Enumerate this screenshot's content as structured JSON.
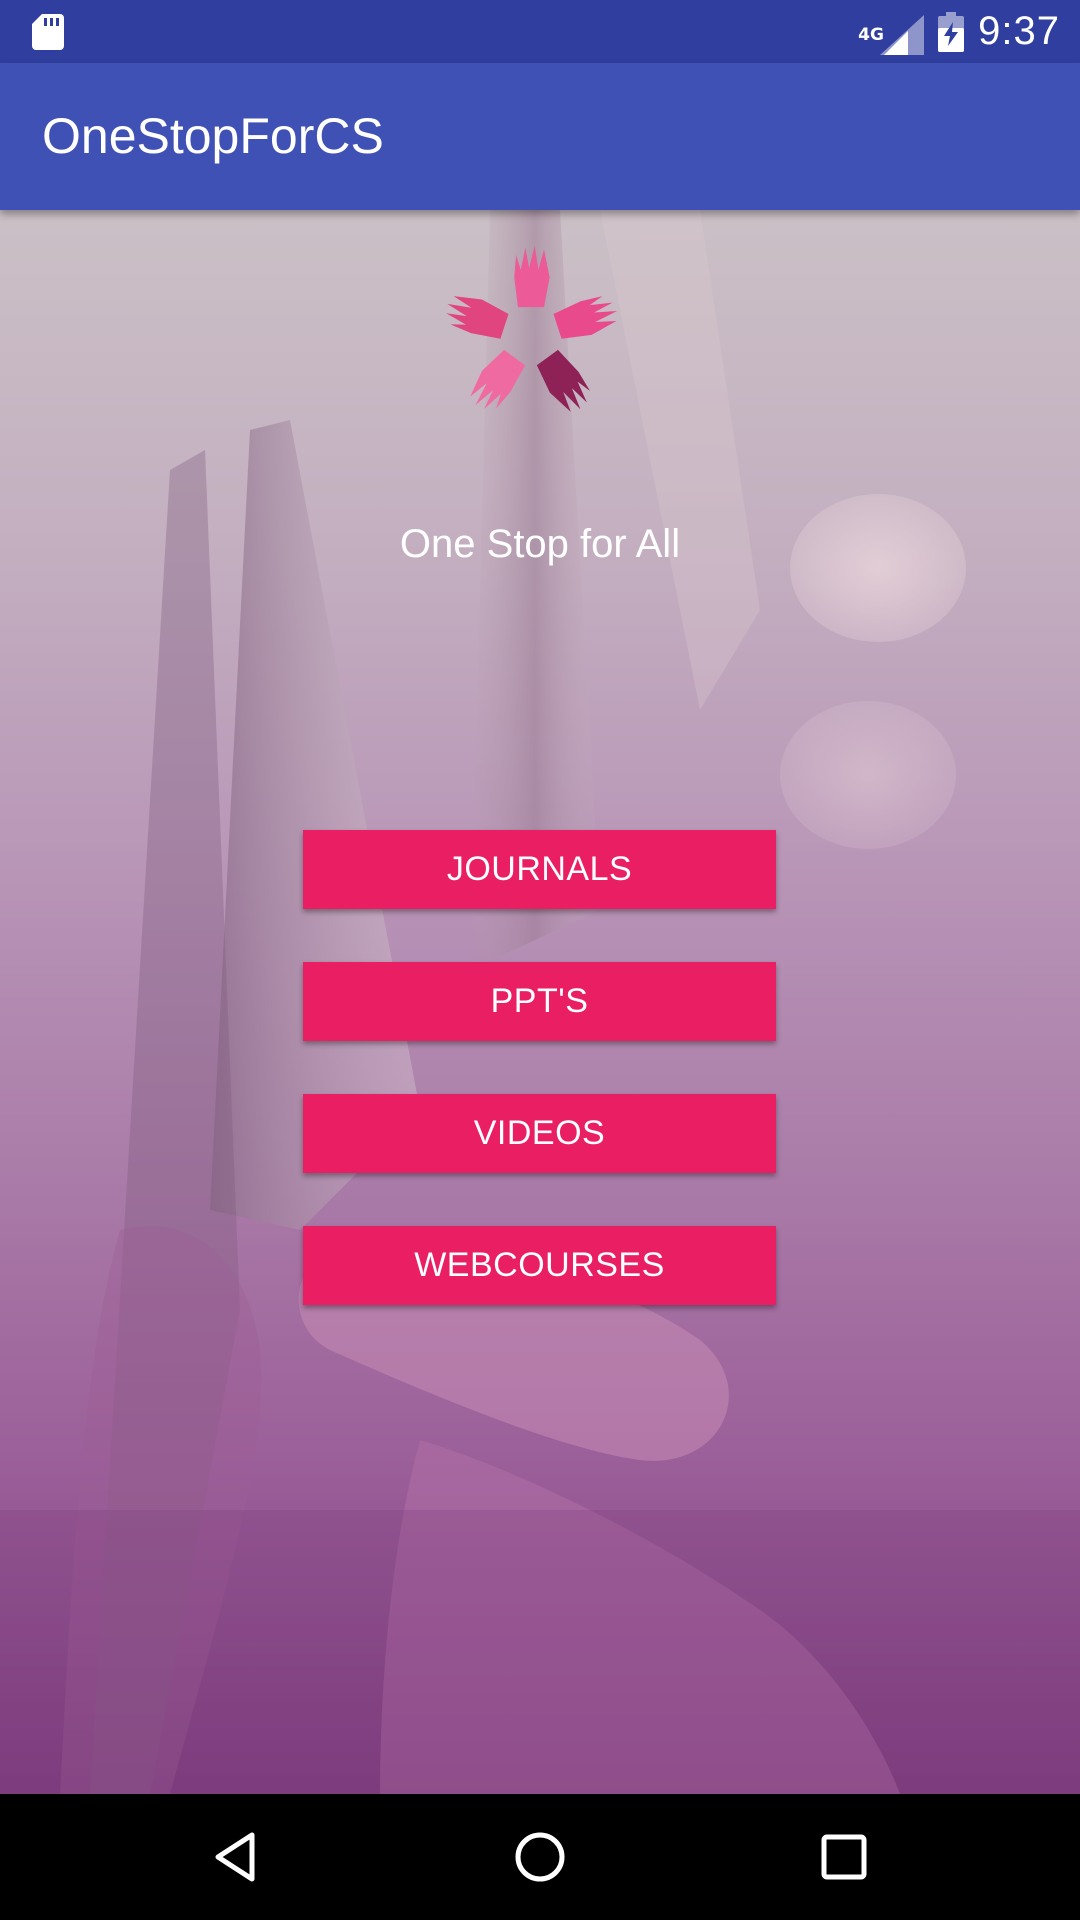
{
  "status_bar": {
    "network_type": "4G",
    "time": "9:37",
    "icons": [
      "sd-card-icon",
      "signal-icon",
      "battery-charging-icon"
    ]
  },
  "app_bar": {
    "title": "OneStopForCS"
  },
  "main": {
    "logo_icon": "hands-star-logo",
    "tagline": "One Stop for All",
    "buttons": [
      {
        "label": "JOURNALS"
      },
      {
        "label": "PPT'S"
      },
      {
        "label": "VIDEOS"
      },
      {
        "label": "WEBCOURSES"
      }
    ]
  },
  "nav_bar": {
    "icons": [
      "back-icon",
      "home-icon",
      "recents-icon"
    ]
  },
  "colors": {
    "status_bar": "#303F9F",
    "app_bar": "#3F51B5",
    "button": "#E91E63",
    "button_text": "#FFFFFF",
    "nav_bar": "#000000"
  }
}
